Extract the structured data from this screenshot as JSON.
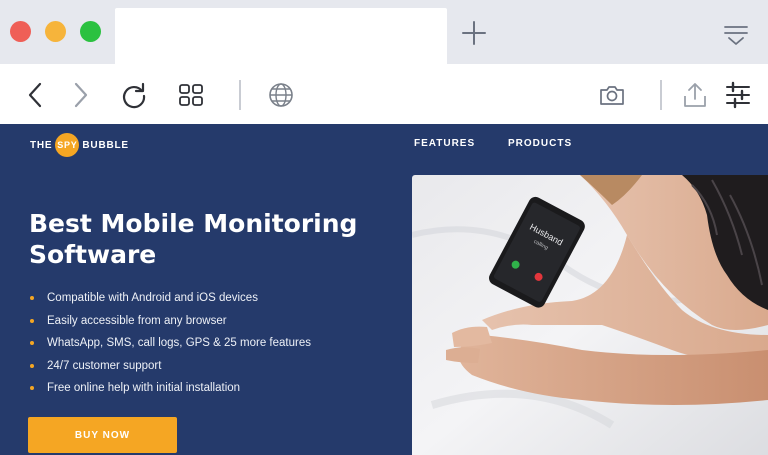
{
  "browser": {
    "tab": {
      "title": ""
    },
    "icons": {
      "close": "close-window-icon",
      "minimize": "minimize-window-icon",
      "zoom": "zoom-window-icon",
      "new_tab": "plus-icon",
      "tab_menu": "tab-overview-icon",
      "back": "chevron-left-icon",
      "forward": "chevron-right-icon",
      "reload": "reload-icon",
      "tabs_grid": "grid-icon",
      "globe": "globe-icon",
      "camera": "camera-icon",
      "share": "share-icon",
      "settings": "sliders-icon"
    },
    "colors": {
      "close": "#ef5f57",
      "minimize": "#f6b43b",
      "zoom": "#2bc140",
      "tabbar": "#e6e8ee"
    }
  },
  "site": {
    "logo": {
      "prefix": "THE",
      "highlight": "SPY",
      "suffix": "BUBBLE"
    },
    "nav": [
      {
        "label": "FEATURES"
      },
      {
        "label": "PRODUCTS"
      }
    ],
    "hero": {
      "title_line1": "Best Mobile Monitoring",
      "title_line2": "Software",
      "features": [
        "Compatible with Android and iOS devices",
        "Easily accessible from any browser",
        "WhatsApp, SMS, call logs, GPS & 25 more features",
        "24/7 customer support",
        "Free online help with initial installation"
      ],
      "cta_label": "BUY NOW",
      "phone_caller": "Husband",
      "phone_status": "calling"
    },
    "colors": {
      "background": "#253a6b",
      "accent": "#f5a623",
      "text": "#ffffff"
    }
  }
}
